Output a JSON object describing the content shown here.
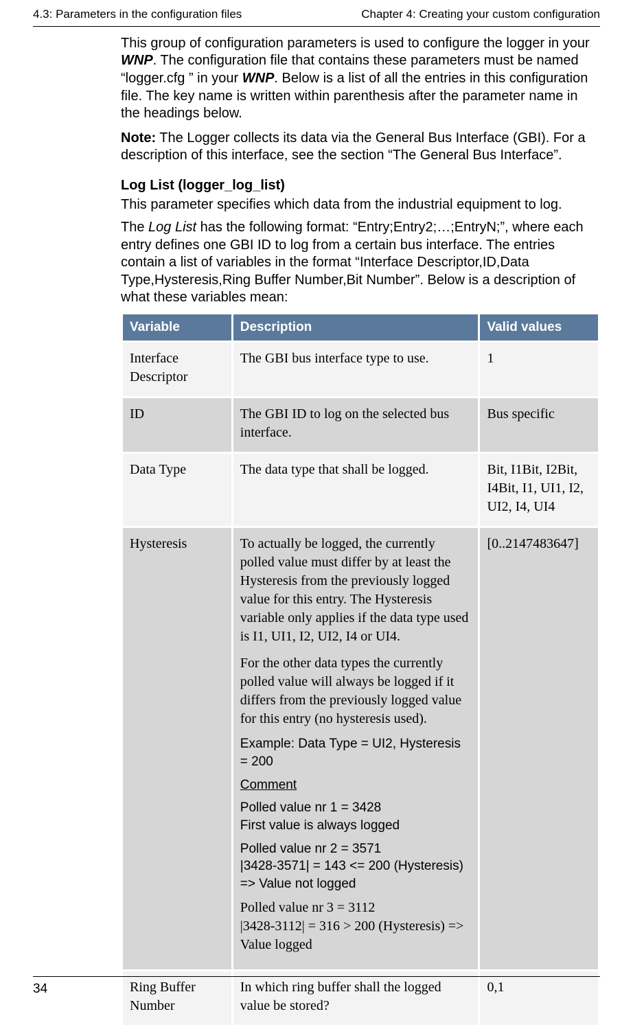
{
  "header": {
    "left": "4.3: Parameters in the configuration files",
    "right": "Chapter 4: Creating your custom configuration"
  },
  "intro": {
    "p1_a": "This group of configuration parameters is used to configure the logger in your ",
    "p1_b": "WNP",
    "p1_c": ". The configuration file that contains these parameters must be named “logger.cfg ” in your ",
    "p1_d": "WNP",
    "p1_e": ". Below is a list of all the entries in this configuration file. The key name is written within parenthesis after the parameter name in the headings below.",
    "note_label": "Note:",
    "note_body": " The Logger collects its data via the General Bus Interface (GBI). For a description of this interface, see the section “The General Bus Interface”."
  },
  "loglist": {
    "heading": "Log List (logger_log_list)",
    "p1": "This parameter specifies which data from the industrial equipment to log.",
    "p2_a": "The ",
    "p2_b": "Log List",
    "p2_c": " has the following format: “Entry;Entry2;…;EntryN;”, where each entry defines one GBI ID to log from a certain bus interface. The entries contain a list of variables in the format “Interface Descriptor,ID,Data Type,Hysteresis,Ring Buffer Number,Bit Number”. Below is a description of what these variables mean:"
  },
  "table": {
    "headers": {
      "c1": "Variable",
      "c2": "Description",
      "c3": "Valid values"
    },
    "rows": [
      {
        "var": "Interface Descriptor",
        "desc": "The GBI bus interface type to use.",
        "val": "1"
      },
      {
        "var": "ID",
        "desc": "The GBI ID to log on the selected bus interface.",
        "val": "Bus specific"
      },
      {
        "var": "Data Type",
        "desc": "The data type that shall be logged.",
        "val": "Bit, I1Bit, I2Bit, I4Bit, I1, UI1, I2, UI2, I4, UI4"
      },
      {
        "var": "Hysteresis",
        "desc_p1": "To actually be logged, the currently polled value must differ by at least the Hysteresis from the previously logged value for this entry. The Hysteresis variable only applies if the data type used is I1, UI1, I2, UI2, I4 or UI4.",
        "desc_p2": "For the other data types the currently polled value will always be logged if it differs from the previously logged value for this entry (no hysteresis used).",
        "ex_title": "Example: Data Type = UI2, Hysteresis = 200",
        "ex_comment": "Comment",
        "ex_l1a": "Polled value nr 1 = 3428",
        "ex_l1b": "First value is always logged",
        "ex_l2a": "Polled value nr 2 = 3571",
        "ex_l2b": "|3428-3571| = 143 <= 200 (Hysteresis) => Value not logged",
        "ex_l3a": "Polled value nr 3 = 3112",
        "ex_l3b": "|3428-3112| = 316 > 200 (Hysteresis) => Value logged",
        "val": "[0..2147483647]"
      },
      {
        "var": "Ring Buffer Number",
        "desc": "In which ring buffer shall the logged value be stored?",
        "val": "0,1"
      }
    ]
  },
  "footer": {
    "page": "34"
  }
}
